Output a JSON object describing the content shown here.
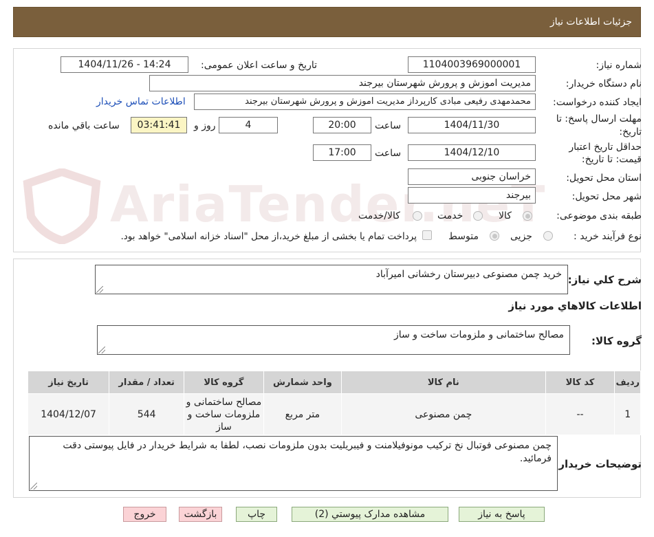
{
  "header": {
    "title": "جزئیات اطلاعات نیاز"
  },
  "watermark": {
    "text": "AriaTender.neT"
  },
  "fields": {
    "need_number_label": "شماره نیاز:",
    "need_number": "1104003969000001",
    "announce_label": "تاریخ و ساعت اعلان عمومی:",
    "announce_value": "1404/11/26 - 14:24",
    "buyer_org_label": "نام دستگاه خریدار:",
    "buyer_org": "مدیریت اموزش و پرورش شهرستان بیرجند",
    "requester_label": "ایجاد کننده درخواست:",
    "requester": "محمدمهدی رفیعی مبادی کارپرداز مدیریت اموزش و پرورش شهرستان بیرجند",
    "contact_link": "اطلاعات تماس خریدار",
    "deadline_label_1": "مهلت ارسال پاسخ: تا",
    "deadline_label_2": "تاریخ:",
    "deadline_date": "1404/11/30",
    "hour_label": "ساعت",
    "deadline_time": "20:00",
    "days_value": "4",
    "days_label": "روز و",
    "remaining_time": "03:41:41",
    "remaining_label": "ساعت باقي مانده",
    "validity_label_1": "حداقل تاریخ اعتبار",
    "validity_label_2": "قیمت: تا تاریخ:",
    "validity_date": "1404/12/10",
    "validity_hour_label": "ساعت",
    "validity_time": "17:00",
    "province_label": "استان محل تحویل:",
    "province": "خراسان جنوبی",
    "city_label": "شهر محل تحویل:",
    "city": "بیرجند",
    "category_label": "طبقه بندی موضوعی:",
    "category_options": [
      "کالا",
      "خدمت",
      "کالا/خدمت"
    ],
    "process_label": "نوع فرآیند خرید :",
    "process_options": [
      "جزیی",
      "متوسط"
    ],
    "payment_note": "پرداخت تمام یا بخشی از مبلغ خرید،از محل \"اسناد خزانه اسلامی\" خواهد بود."
  },
  "summary": {
    "label": "شرح کلي نياز:",
    "value": "خرید چمن مصنوعی دبیرستان رخشانی امیرآباد"
  },
  "goods_section": {
    "title": "اطلاعات کالاهاي مورد نياز",
    "group_label": "گروه کالا:",
    "group_value": "مصالح ساختمانی و ملزومات ساخت و ساز"
  },
  "table": {
    "headers": [
      "رديف",
      "کد کالا",
      "نام کالا",
      "واحد شمارش",
      "گروه کالا",
      "تعداد / مقدار",
      "تاريخ نياز"
    ],
    "rows": [
      [
        "1",
        "--",
        "چمن مصنوعی",
        "متر مربع",
        "مصالح ساختمانی و ملزومات ساخت و ساز",
        "544",
        "1404/12/07"
      ]
    ]
  },
  "buyer_notes": {
    "label": "توضیحات خریدار:",
    "value": "چمن مصنوعی فوتبال نخ ترکیب مونوفیلامنت و فیبریلیت بدون ملزومات نصب، لطفا به شرایط خریدار در فایل پیوستی دقت فرمائید."
  },
  "buttons": {
    "respond": "پاسخ به نیاز",
    "attachments": "مشاهده مدارک پیوستي (2)",
    "print": "چاپ",
    "back": "بازگشت",
    "exit": "خروج"
  },
  "colors": {
    "header_bg": "#7a5f3c",
    "button_green": "#e5f3d8",
    "button_pink": "#fbd3d6",
    "link": "#1d4fb8",
    "timer_bg": "#fbf5c4"
  }
}
